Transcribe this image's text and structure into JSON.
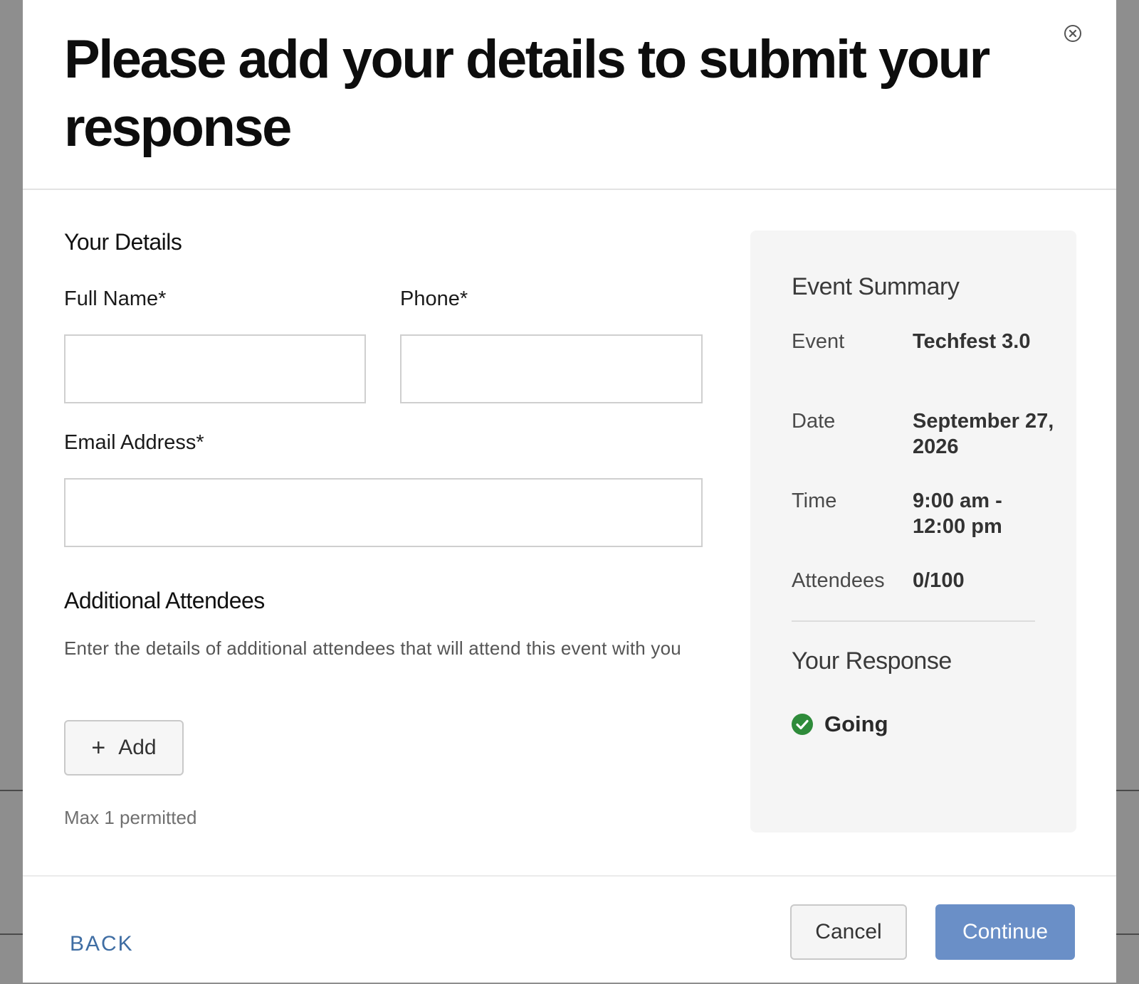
{
  "modal": {
    "title": "Please add your details to submit your response"
  },
  "your_details": {
    "heading": "Your Details",
    "full_name_label": "Full Name*",
    "full_name_value": "",
    "phone_label": "Phone*",
    "phone_value": "",
    "email_label": "Email Address*",
    "email_value": ""
  },
  "additional_attendees": {
    "heading": "Additional Attendees",
    "help_text": "Enter the details of additional attendees that will attend this event with you",
    "add_label": "Add",
    "max_text": "Max 1 permitted"
  },
  "summary": {
    "heading": "Event Summary",
    "rows": [
      {
        "label": "Event",
        "value": "Techfest 3.0"
      },
      {
        "label": "Date",
        "value": "September 27, 2026"
      },
      {
        "label": "Time",
        "value": "9:00 am - 12:00 pm"
      },
      {
        "label": "Attendees",
        "value": "0/100"
      }
    ],
    "response_heading": "Your Response",
    "response_value": "Going"
  },
  "footer": {
    "back_label": "BACK",
    "cancel_label": "Cancel",
    "continue_label": "Continue"
  },
  "colors": {
    "accent_link": "#3f6da3",
    "primary_button": "#6a8fc7",
    "success_icon": "#2e8b3a"
  },
  "icons": {
    "close": "close-circle-icon",
    "add": "plus-icon",
    "response": "check-circle-icon"
  }
}
